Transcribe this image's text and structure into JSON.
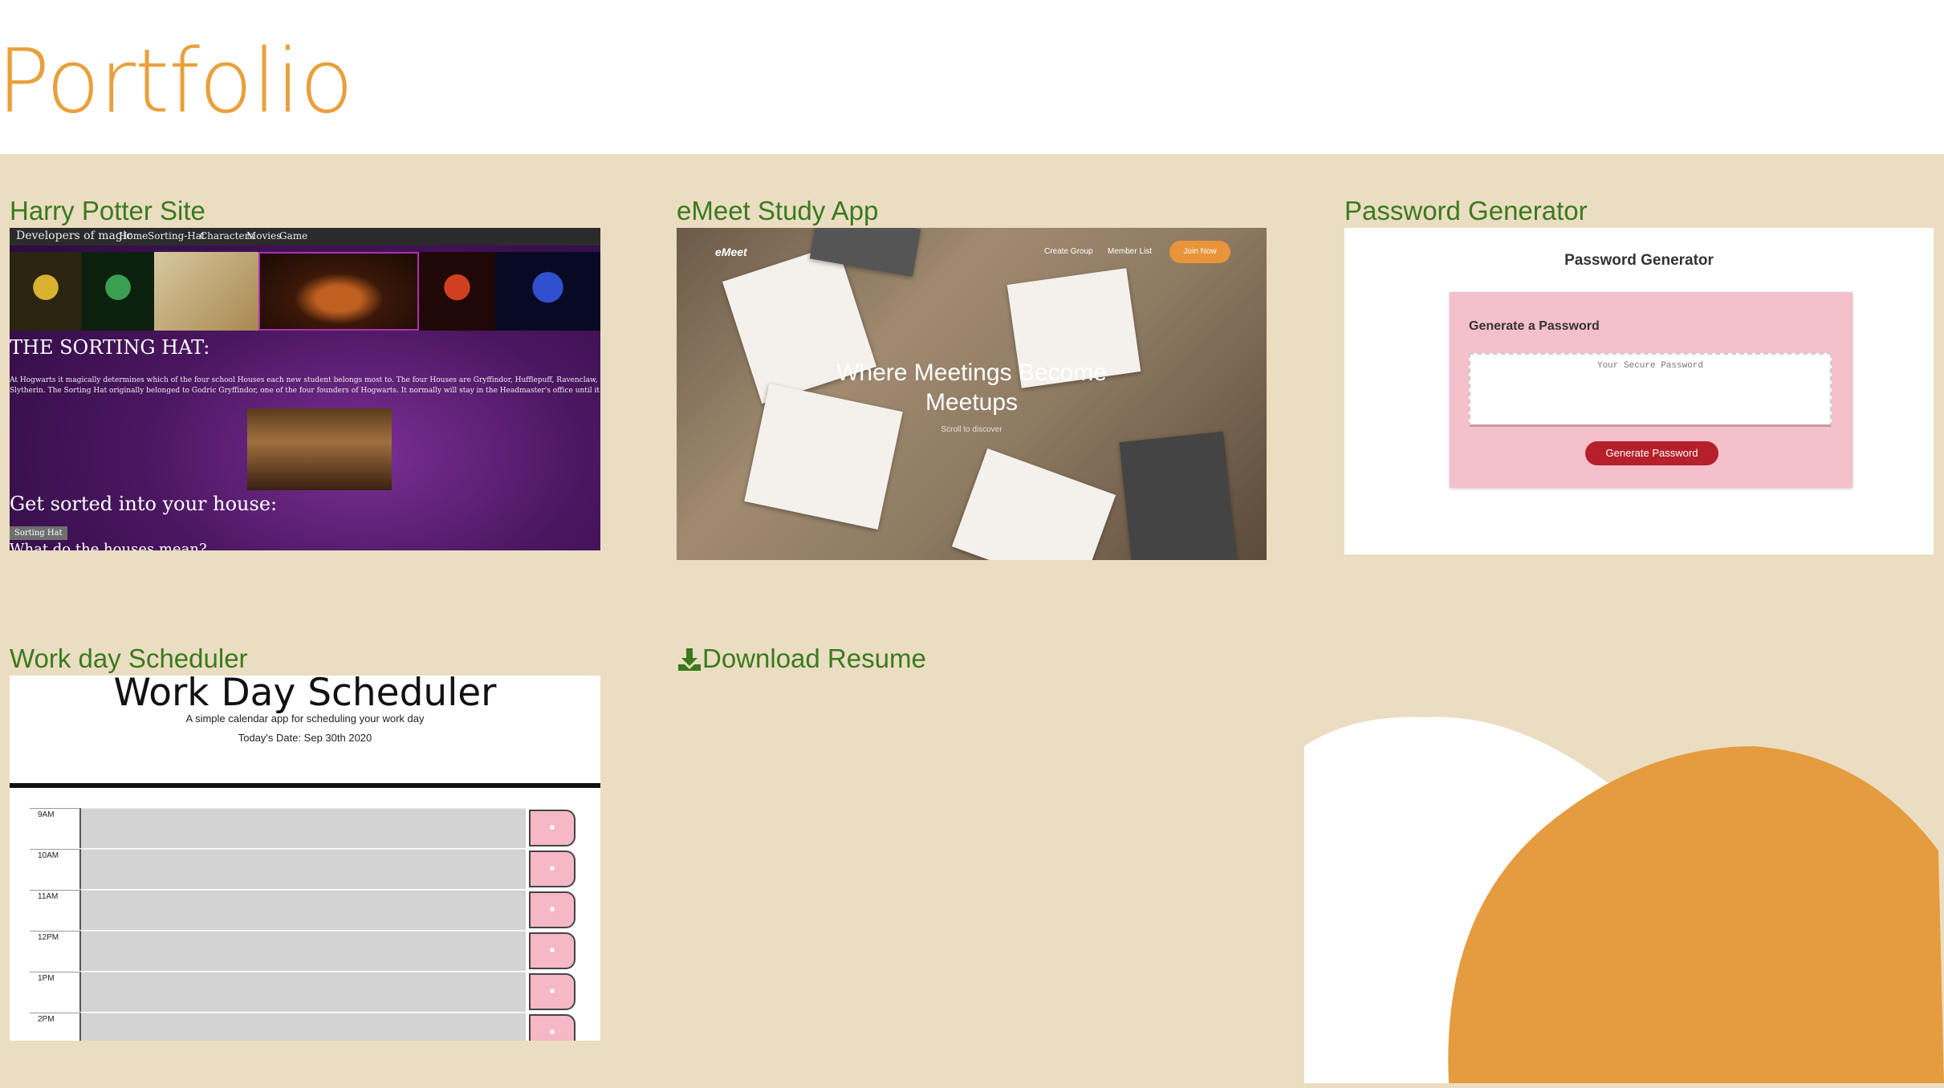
{
  "header": {
    "title": "Portfolio"
  },
  "projects": [
    {
      "id": "harry-potter",
      "title": "Harry Potter Site",
      "screenshot": {
        "brand": "Developers of magic",
        "nav": [
          "Home",
          "Sorting-Hat",
          "Characters",
          "Movies",
          "Game"
        ],
        "heading": "THE SORTING HAT:",
        "paragraph_line1": "At Hogwarts it magically determines which of the four school Houses each new student belongs most to. The four Houses are Gryffindor, Hufflepuff, Ravenclaw, and",
        "paragraph_line2": "Slytherin. The Sorting Hat originally belonged to Godric Gryffindor, one of the four founders of Hogwarts. It normally will stay in the Headmaster's office until it is needed",
        "subheading": "Get sorted into your house:",
        "button": "Sorting Hat",
        "partial_heading": "What do the houses mean?"
      }
    },
    {
      "id": "emeet",
      "title": "eMeet Study App",
      "screenshot": {
        "brand": "eMeet",
        "nav": [
          "Create Group",
          "Member List"
        ],
        "cta": "Join Now",
        "hero_line1": "Where Meetings Become",
        "hero_line2": "Meetups",
        "scroll_hint": "Scroll to discover"
      }
    },
    {
      "id": "password-generator",
      "title": "Password Generator",
      "screenshot": {
        "heading": "Password Generator",
        "card_heading": "Generate a Password",
        "placeholder": "Your Secure Password",
        "button": "Generate Password"
      }
    },
    {
      "id": "work-day-scheduler",
      "title": "Work day Scheduler",
      "screenshot": {
        "heading": "Work Day Scheduler",
        "lead": "A simple calendar app for scheduling your work day",
        "date": "Today's Date: Sep 30th 2020",
        "hours": [
          "9AM",
          "10AM",
          "11AM",
          "12PM",
          "1PM",
          "2PM"
        ]
      }
    }
  ],
  "download": {
    "label": "Download Resume",
    "icon": "download-icon"
  },
  "colors": {
    "accent": "#e9a03c",
    "link": "#3a7a1c",
    "section_bg": "#ebddc2",
    "deco_orange": "#e59c3e"
  }
}
